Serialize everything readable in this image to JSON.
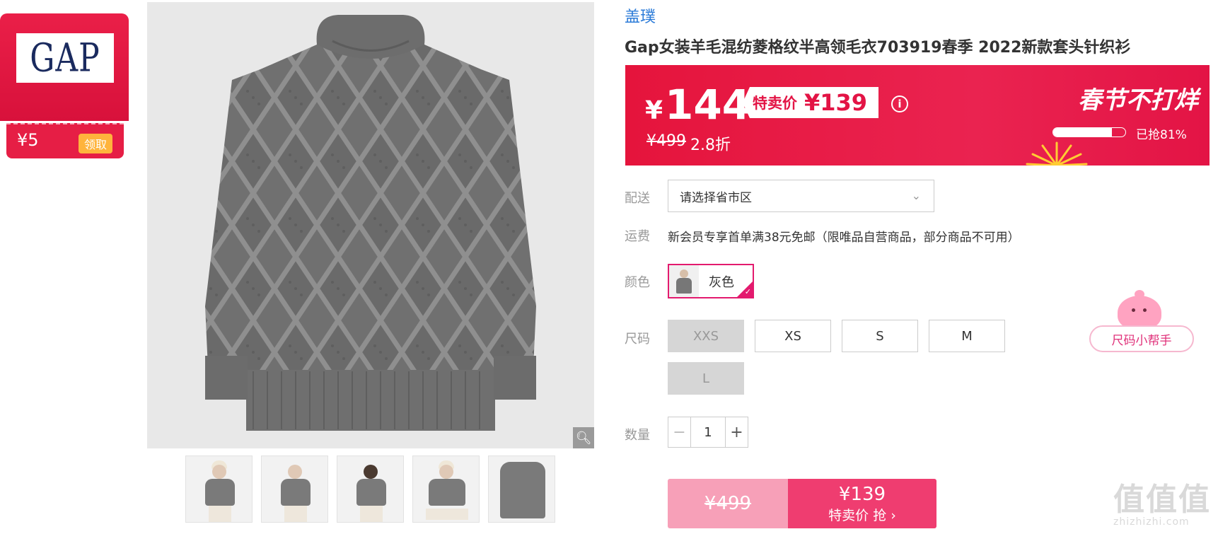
{
  "coupon": {
    "logo": "GAP",
    "amount": "¥5",
    "claim_label": "领取"
  },
  "product": {
    "brand": "盖璞",
    "title": "Gap女装羊毛混纺菱格纹半高领毛衣703919春季 2022新款套头针织衫"
  },
  "price_banner": {
    "currency": "¥",
    "price": "144",
    "special_label": "特卖价",
    "special_price": "¥139",
    "info_icon": "info-icon",
    "original_price": "¥499",
    "discount": "2.8折",
    "promo_title": "春节不打烊",
    "sold_percent": 0.81,
    "sold_label": "已抢81%",
    "banner_color": "#e5143c"
  },
  "delivery": {
    "label": "配送",
    "placeholder": "请选择省市区"
  },
  "shipping": {
    "label": "运费",
    "text": "新会员专享首单满38元免邮（限唯品自营商品，部分商品不可用）"
  },
  "color": {
    "label": "颜色",
    "selected": "灰色",
    "accent": "#e31a6e"
  },
  "size": {
    "label": "尺码",
    "options": [
      {
        "label": "XXS",
        "available": false
      },
      {
        "label": "XS",
        "available": true
      },
      {
        "label": "S",
        "available": true
      },
      {
        "label": "M",
        "available": true
      },
      {
        "label": "L",
        "available": false
      }
    ]
  },
  "size_helper": {
    "label": "尺码小帮手"
  },
  "quantity": {
    "label": "数量",
    "value": "1",
    "minus": "−",
    "plus": "+"
  },
  "buy": {
    "original_price": "¥499",
    "price": "¥139",
    "label": "特卖价 抢 ›",
    "accent": "#ef3d70"
  },
  "watermark": {
    "big": "值值值",
    "small": "zhizhizhi.com"
  }
}
